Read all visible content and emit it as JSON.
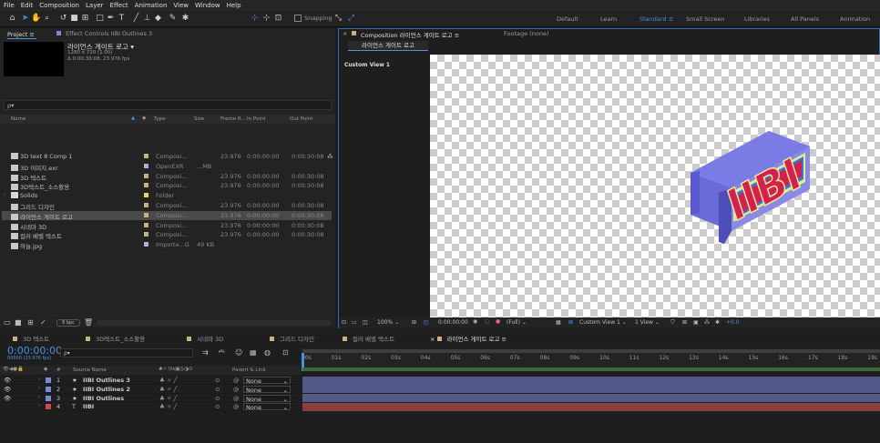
{
  "menu": [
    "File",
    "Edit",
    "Composition",
    "Layer",
    "Effect",
    "Animation",
    "View",
    "Window",
    "Help"
  ],
  "toolbar": {
    "snapping_label": "Snapping"
  },
  "workspaces": [
    {
      "label": "Default",
      "active": false
    },
    {
      "label": "Learn",
      "active": false
    },
    {
      "label": "Standard",
      "active": true
    },
    {
      "label": "Small Screen",
      "active": false
    },
    {
      "label": "Libraries",
      "active": false
    },
    {
      "label": "All Panels",
      "active": false
    },
    {
      "label": "Animation",
      "active": false
    }
  ],
  "project_panel": {
    "tab_label": "Project",
    "effect_controls_tab": "Effect Controls IIBI Outlines 3",
    "selected_name": "라이언스 게이트 로고 ▾",
    "selected_res": "1280 x 720 (1.00)",
    "selected_dur": "Δ 0:00:30:08, 23.976 fps",
    "search_placeholder": "ρ▾",
    "bpc_label": "8 bpc",
    "columns": {
      "name": "Name",
      "type": "Type",
      "size": "Size",
      "frame_rate": "Frame R...",
      "in_point": "In Point",
      "out_point": "Out Point"
    },
    "items": [
      {
        "name": "3D text 8 Comp 1",
        "type": "Composi...",
        "size": "",
        "fr": "23.976",
        "in": "0:00:00:00",
        "out": "0:00:30:08",
        "color": "#c9b27a",
        "selected": false,
        "folder": false
      },
      {
        "name": "3D 이미지.exr",
        "type": "OpenEXR",
        "size": "...MB",
        "fr": "",
        "in": "",
        "out": "",
        "color": "#b0b0e0",
        "selected": false,
        "folder": false
      },
      {
        "name": "3D 텍스트",
        "type": "Composi...",
        "size": "",
        "fr": "23.976",
        "in": "0:00:00:00",
        "out": "0:00:30:08",
        "color": "#c9b27a",
        "selected": false,
        "folder": false
      },
      {
        "name": "3D텍스트_소스활용",
        "type": "Composi...",
        "size": "",
        "fr": "23.976",
        "in": "0:00:00:00",
        "out": "0:00:30:08",
        "color": "#c9b27a",
        "selected": false,
        "folder": false
      },
      {
        "name": "Solids",
        "type": "Folder",
        "size": "",
        "fr": "",
        "in": "",
        "out": "",
        "color": "#e8d84a",
        "selected": false,
        "folder": true
      },
      {
        "name": "그리드 디자인",
        "type": "Composi...",
        "size": "",
        "fr": "23.976",
        "in": "0:00:00:00",
        "out": "0:00:30:08",
        "color": "#c9b27a",
        "selected": false,
        "folder": false
      },
      {
        "name": "라이언스 게이트 로고",
        "type": "Composi...",
        "size": "",
        "fr": "23.976",
        "in": "0:00:00:00",
        "out": "0:00:30:08",
        "color": "#c9b27a",
        "selected": true,
        "folder": false
      },
      {
        "name": "시네마 3D",
        "type": "Composi...",
        "size": "",
        "fr": "23.976",
        "in": "0:00:00:00",
        "out": "0:00:30:08",
        "color": "#c9b27a",
        "selected": false,
        "folder": false
      },
      {
        "name": "컬러 베벨 텍스트",
        "type": "Composi...",
        "size": "",
        "fr": "23.976",
        "in": "0:00:00:00",
        "out": "0:00:30:08",
        "color": "#c9b27a",
        "selected": false,
        "folder": false
      },
      {
        "name": "하늘.jpg",
        "type": "Importe...G",
        "size": "49 KB",
        "fr": "",
        "in": "",
        "out": "",
        "color": "#b0b0e0",
        "selected": false,
        "folder": false
      }
    ]
  },
  "comp_panel": {
    "tab_label": "Composition 라이언스 게이트 로고",
    "footage_tab": "Footage (none)",
    "subtab": "라이언스 게이트 로고",
    "view_label": "Custom View 1",
    "logo_text": "IIBI",
    "zoom": "100%",
    "timecode": "0:00:00:00",
    "quality": "(Full)",
    "view_dropdown": "Custom View 1",
    "views_count": "1 View",
    "exposure": "+0.0"
  },
  "timeline": {
    "tabs": [
      {
        "label": "3D 텍스트",
        "color": "#c9b27a",
        "active": false
      },
      {
        "label": "3D텍스트_소스활용",
        "color": "#c9b27a",
        "active": false
      },
      {
        "label": "시네마 3D",
        "color": "#c9b27a",
        "active": false
      },
      {
        "label": "그리드 디자인",
        "color": "#c9b27a",
        "active": false
      },
      {
        "label": "컬러 베벨 텍스트",
        "color": "#c9b27a",
        "active": false
      },
      {
        "label": "라이언스 게이트 로고",
        "color": "#c9b27a",
        "active": true
      }
    ],
    "timecode": "0:00:00:00",
    "fps_sub": "00000 (23.976 fps)",
    "search_placeholder": "ρ▾",
    "col_source": "Source Name",
    "col_parent": "Parent & Link",
    "ruler": [
      "00s",
      "01s",
      "02s",
      "03s",
      "04s",
      "05s",
      "06s",
      "07s",
      "08s",
      "09s",
      "10s",
      "11s",
      "12s",
      "13s",
      "14s",
      "15s",
      "16s",
      "17s",
      "18s",
      "19s"
    ],
    "layers": [
      {
        "num": "1",
        "type": "★",
        "name": "IIBI Outlines 3",
        "parent": "None",
        "color": "#7a8ad8",
        "bar": "#525a8a"
      },
      {
        "num": "2",
        "type": "★",
        "name": "IIBI Outlines 2",
        "parent": "None",
        "color": "#7a8ad8",
        "bar": "#525a8a"
      },
      {
        "num": "3",
        "type": "★",
        "name": "IIBI Outlines",
        "parent": "None",
        "color": "#7a8ad8",
        "bar": "#525a8a"
      },
      {
        "num": "4",
        "type": "T",
        "name": "IIBI",
        "parent": "None",
        "color": "#d04848",
        "bar": "#8a3f3f"
      }
    ]
  }
}
